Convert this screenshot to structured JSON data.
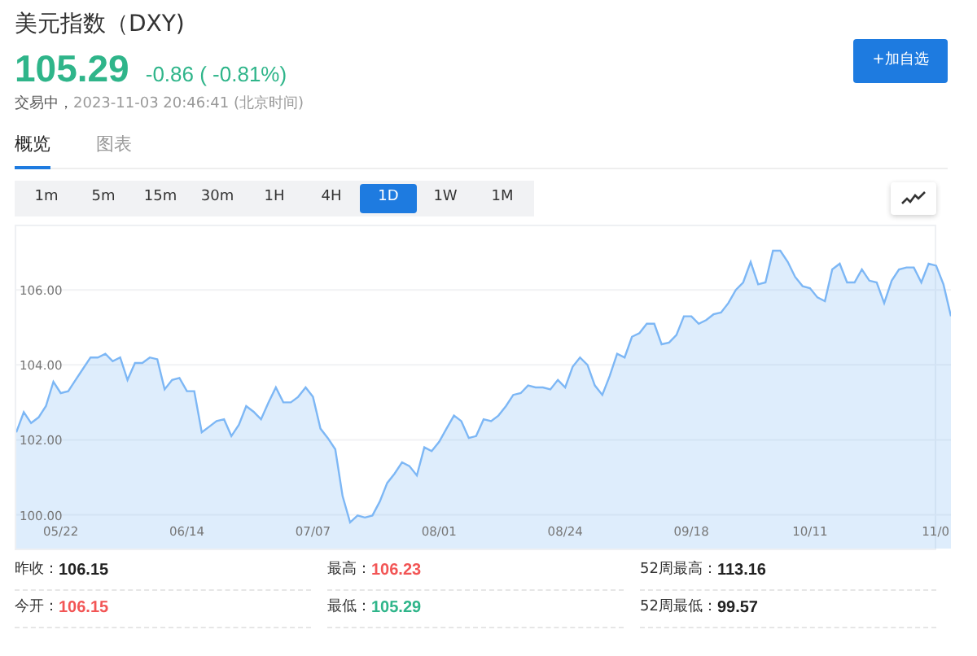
{
  "title": "美元指数（DXY)",
  "add_button": "+加自选",
  "quote": {
    "price": "105.29",
    "change": "-0.86 ( -0.81%)",
    "color": "#2fb58a",
    "status": "交易中，",
    "time": "2023-11-03 20:46:41 (北京时间)"
  },
  "tabs": [
    {
      "label": "概览",
      "selected": true
    },
    {
      "label": "图表",
      "selected": false
    }
  ],
  "periods": [
    {
      "label": "1m",
      "selected": false
    },
    {
      "label": "5m",
      "selected": false
    },
    {
      "label": "15m",
      "selected": false
    },
    {
      "label": "30m",
      "selected": false
    },
    {
      "label": "1H",
      "selected": false
    },
    {
      "label": "4H",
      "selected": false
    },
    {
      "label": "1D",
      "selected": true
    },
    {
      "label": "1W",
      "selected": false
    },
    {
      "label": "1M",
      "selected": false
    }
  ],
  "chart": {
    "chart_data": {
      "type": "area",
      "grid": true,
      "ylim": [
        99.1,
        107.7
      ],
      "categories": [
        null,
        null,
        null,
        null,
        null,
        null,
        "05/22",
        null,
        null,
        null,
        null,
        null,
        null,
        null,
        null,
        null,
        null,
        null,
        null,
        null,
        null,
        null,
        null,
        "06/14",
        null,
        null,
        null,
        null,
        null,
        null,
        null,
        null,
        null,
        null,
        null,
        null,
        null,
        null,
        null,
        null,
        "07/07",
        null,
        null,
        null,
        null,
        null,
        null,
        null,
        null,
        null,
        null,
        null,
        null,
        null,
        null,
        null,
        null,
        "08/01",
        null,
        null,
        null,
        null,
        null,
        null,
        null,
        null,
        null,
        null,
        null,
        null,
        null,
        null,
        null,
        null,
        "08/24",
        null,
        null,
        null,
        null,
        null,
        null,
        null,
        null,
        null,
        null,
        null,
        null,
        null,
        null,
        null,
        null,
        "09/18",
        null,
        null,
        null,
        null,
        null,
        null,
        null,
        null,
        null,
        null,
        null,
        null,
        null,
        null,
        null,
        "10/11",
        null,
        null,
        null,
        null,
        null,
        null,
        null,
        null,
        null,
        null,
        null,
        null,
        null,
        null,
        null,
        null,
        "11/0",
        null,
        null
      ],
      "yticks": [
        {
          "value": 100,
          "label": "100.00"
        },
        {
          "value": 102,
          "label": "102.00"
        },
        {
          "value": 104,
          "label": "104.00"
        },
        {
          "value": 106,
          "label": "106.00"
        }
      ],
      "series": [
        {
          "color": "#7db7f5",
          "values": [
            102.2,
            102.74,
            102.45,
            102.6,
            102.9,
            103.55,
            103.25,
            103.3,
            103.6,
            103.9,
            104.2,
            104.2,
            104.3,
            104.1,
            104.2,
            103.6,
            104.05,
            104.05,
            104.2,
            104.15,
            103.35,
            103.6,
            103.65,
            103.3,
            103.3,
            102.2,
            102.35,
            102.5,
            102.55,
            102.1,
            102.4,
            102.9,
            102.75,
            102.55,
            103.0,
            103.4,
            103.0,
            103.0,
            103.15,
            103.4,
            103.15,
            102.3,
            102.05,
            101.75,
            100.5,
            99.8,
            99.98,
            99.93,
            99.98,
            100.35,
            100.85,
            101.1,
            101.4,
            101.3,
            101.05,
            101.8,
            101.7,
            101.95,
            102.3,
            102.65,
            102.5,
            102.05,
            102.1,
            102.55,
            102.5,
            102.65,
            102.9,
            103.2,
            103.25,
            103.45,
            103.4,
            103.4,
            103.35,
            103.6,
            103.4,
            103.95,
            104.2,
            104.0,
            103.45,
            103.2,
            103.7,
            104.3,
            104.2,
            104.75,
            104.85,
            105.1,
            105.1,
            104.55,
            104.6,
            104.8,
            105.3,
            105.3,
            105.1,
            105.2,
            105.35,
            105.4,
            105.65,
            106.0,
            106.2,
            106.75,
            106.15,
            106.2,
            107.05,
            107.05,
            106.75,
            106.35,
            106.1,
            106.05,
            105.8,
            105.7,
            106.55,
            106.7,
            106.2,
            106.2,
            106.55,
            106.25,
            106.2,
            105.65,
            106.25,
            106.55,
            106.6,
            106.6,
            106.2,
            106.7,
            106.65,
            106.15,
            105.3
          ]
        }
      ]
    }
  },
  "stats": [
    [
      {
        "label": "昨收：",
        "value": "106.15",
        "color": "#222222"
      },
      {
        "label": "最高：",
        "value": "106.23",
        "color": "#f25555"
      },
      {
        "label": "52周最高：",
        "value": "113.16",
        "color": "#222222"
      }
    ],
    [
      {
        "label": "今开：",
        "value": "106.15",
        "color": "#f25555"
      },
      {
        "label": "最低：",
        "value": "105.29",
        "color": "#2fb58a"
      },
      {
        "label": "52周最低：",
        "value": "99.57",
        "color": "#222222"
      }
    ]
  ]
}
